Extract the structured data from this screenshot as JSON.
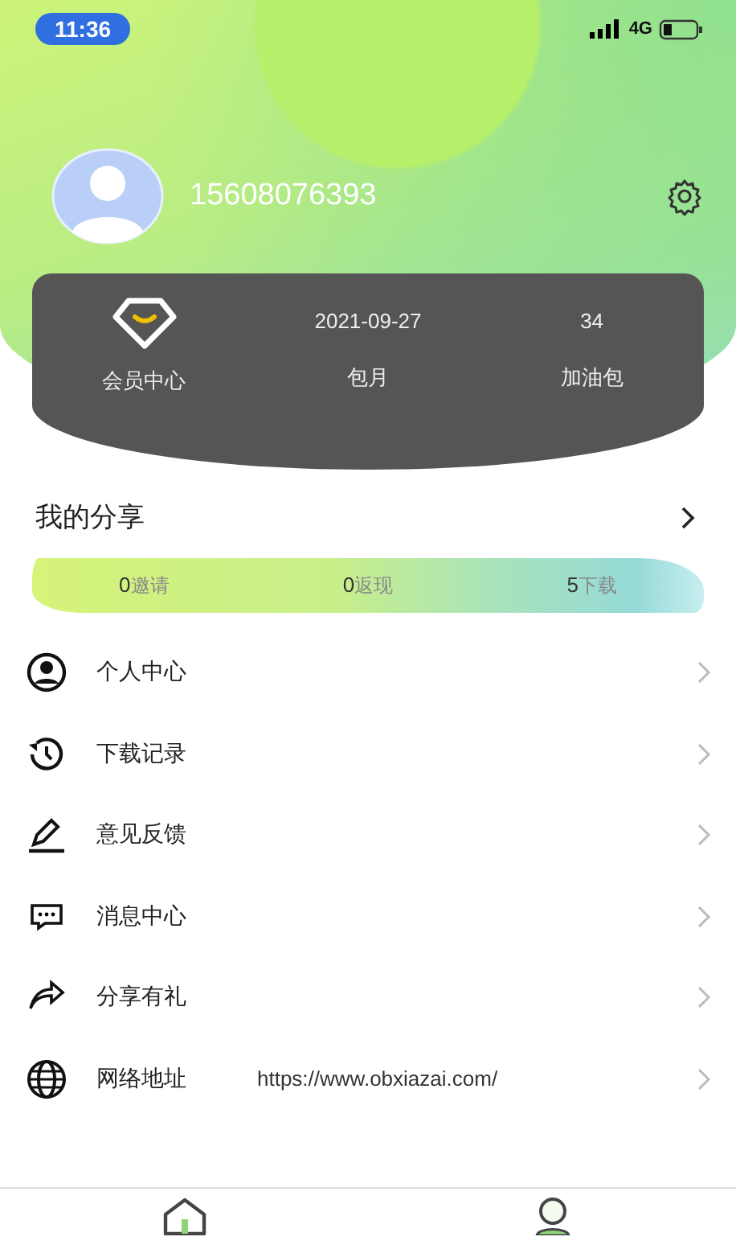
{
  "status_bar": {
    "time": "11:36",
    "network": "4G"
  },
  "profile": {
    "phone": "15608076393"
  },
  "member_card": {
    "items": [
      {
        "label": "会员中心"
      },
      {
        "value": "2021-09-27",
        "label": "包月"
      },
      {
        "value": "34",
        "label": "加油包"
      }
    ]
  },
  "share": {
    "title": "我的分享",
    "stats": [
      {
        "count": "0",
        "label": "邀请"
      },
      {
        "count": "0",
        "label": "返现"
      },
      {
        "count": "5",
        "label": "下载"
      }
    ]
  },
  "menu": [
    {
      "label": "个人中心"
    },
    {
      "label": "下载记录"
    },
    {
      "label": "意见反馈"
    },
    {
      "label": "消息中心"
    },
    {
      "label": "分享有礼"
    },
    {
      "label": "网络地址",
      "value": "https://www.obxiazai.com/"
    }
  ],
  "tab_bar": [
    {
      "selected": false
    },
    {
      "selected": true
    }
  ]
}
